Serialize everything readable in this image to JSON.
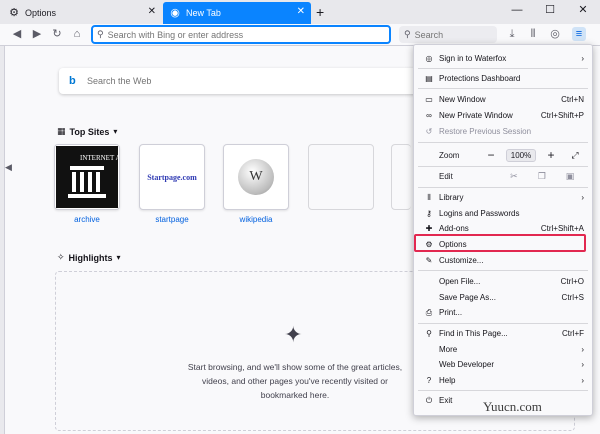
{
  "tabs": [
    {
      "title": "Options",
      "icon": "gear-icon"
    },
    {
      "title": "New Tab",
      "icon": "firefox-icon"
    }
  ],
  "navbar": {
    "url_placeholder": "Search with Bing or enter address",
    "search_placeholder": "Search"
  },
  "newtab": {
    "web_search_placeholder": "Search the Web",
    "top_sites_label": "Top Sites",
    "highlights_label": "Highlights",
    "sites": [
      {
        "label": "archive",
        "tile_text": "INTERNET ARCHIVE"
      },
      {
        "label": "startpage",
        "tile_text": "Startpage.com"
      },
      {
        "label": "wikipedia",
        "tile_text": "W"
      }
    ],
    "highlights_empty_text": "Start browsing, and we'll show some of the great articles, videos, and other pages you've recently visited or bookmarked here."
  },
  "menu": {
    "sign_in": "Sign in to Waterfox",
    "protections": "Protections Dashboard",
    "new_window": {
      "label": "New Window",
      "shortcut": "Ctrl+N"
    },
    "new_private_window": {
      "label": "New Private Window",
      "shortcut": "Ctrl+Shift+P"
    },
    "restore_session": "Restore Previous Session",
    "zoom_label": "Zoom",
    "zoom_value": "100%",
    "edit_label": "Edit",
    "library": "Library",
    "logins": "Logins and Passwords",
    "addons": {
      "label": "Add-ons",
      "shortcut": "Ctrl+Shift+A"
    },
    "options": "Options",
    "customize": "Customize...",
    "open_file": {
      "label": "Open File...",
      "shortcut": "Ctrl+O"
    },
    "save_page": {
      "label": "Save Page As...",
      "shortcut": "Ctrl+S"
    },
    "print": "Print...",
    "find": {
      "label": "Find in This Page...",
      "shortcut": "Ctrl+F"
    },
    "more": "More",
    "web_developer": "Web Developer",
    "help": "Help",
    "exit": "Exit"
  },
  "watermark": "Yuucn.com",
  "colors": {
    "accent": "#0a84ff",
    "highlight_box": "#e22850"
  }
}
